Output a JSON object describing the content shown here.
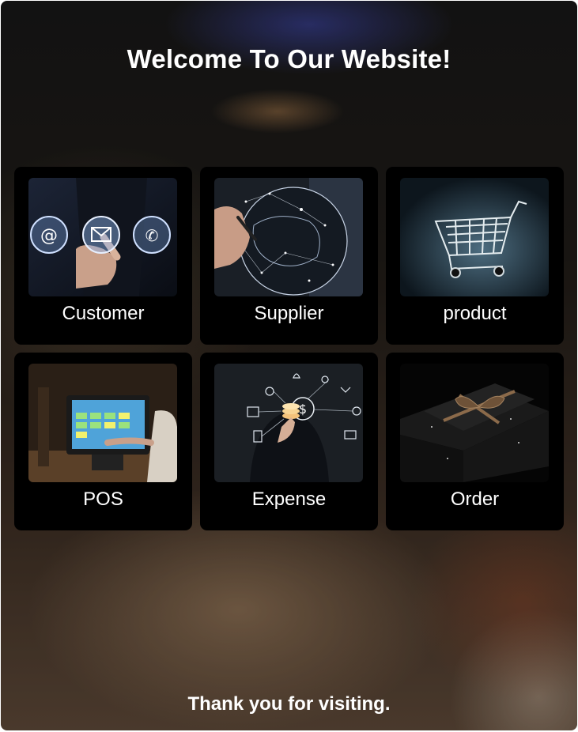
{
  "header": {
    "title": "Welcome To Our Website!"
  },
  "cards": [
    {
      "label": "Customer",
      "icon": "customer-contact-icon"
    },
    {
      "label": "Supplier",
      "icon": "supplier-globe-icon"
    },
    {
      "label": "product",
      "icon": "shopping-cart-icon"
    },
    {
      "label": "POS",
      "icon": "pos-terminal-icon"
    },
    {
      "label": "Expense",
      "icon": "expense-dollar-icon"
    },
    {
      "label": "Order",
      "icon": "gift-box-icon"
    }
  ],
  "footer": {
    "text": "Thank you for visiting."
  }
}
